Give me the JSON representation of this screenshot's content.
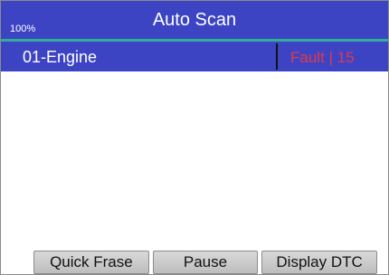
{
  "header": {
    "battery": "100%",
    "title": "Auto Scan"
  },
  "rows": [
    {
      "module": "01-Engine",
      "status": "Fault | 15"
    }
  ],
  "buttons": {
    "quick_erase": "Quick Frase",
    "pause": "Pause",
    "display_dtc": "Display DTC"
  },
  "colors": {
    "header_bg": "#3d44c4",
    "accent_rule": "#2fae9a",
    "fault_text": "#e13a4a"
  }
}
